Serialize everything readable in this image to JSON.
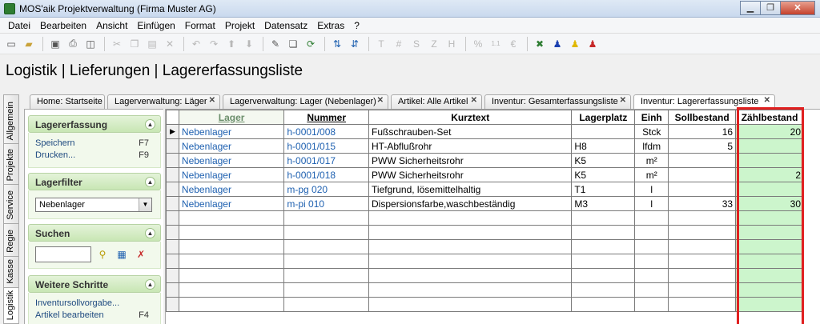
{
  "window": {
    "title": "MOS'aik Projektverwaltung (Firma Muster AG)",
    "minimize": "▁",
    "maximize": "❐",
    "close": "✕"
  },
  "menu": [
    "Datei",
    "Bearbeiten",
    "Ansicht",
    "Einfügen",
    "Format",
    "Projekt",
    "Datensatz",
    "Extras",
    "?"
  ],
  "breadcrumb": "Logistik | Lieferungen | Lagererfassungsliste",
  "tabs": [
    {
      "label": "Home: Startseite"
    },
    {
      "label": "Lagerverwaltung: Läger"
    },
    {
      "label": "Lagerverwaltung: Lager (Nebenlager)"
    },
    {
      "label": "Artikel: Alle Artikel"
    },
    {
      "label": "Inventur: Gesamterfassungsliste"
    },
    {
      "label": "Inventur: Lagererfassungsliste"
    }
  ],
  "tab_close": "✕",
  "side_tabs": [
    "Allgemein",
    "Projekte",
    "Service",
    "Regie",
    "Kasse",
    "Logistik"
  ],
  "panel": {
    "lagererfassung": {
      "title": "Lagererfassung",
      "items": [
        {
          "label": "Speichern",
          "shortcut": "F7"
        },
        {
          "label": "Drucken...",
          "shortcut": "F9"
        }
      ]
    },
    "lagerfilter": {
      "title": "Lagerfilter",
      "selected": "Nebenlager"
    },
    "suchen": {
      "title": "Suchen",
      "value": ""
    },
    "weitere": {
      "title": "Weitere Schritte",
      "items": [
        {
          "label": "Inventursollvorgabe...",
          "shortcut": ""
        },
        {
          "label": "Artikel bearbeiten",
          "shortcut": "F4"
        }
      ]
    },
    "collapse_glyph": "▲"
  },
  "table": {
    "columns": [
      "Lager",
      "Nummer",
      "Kurztext",
      "Lagerplatz",
      "Einh",
      "Sollbestand",
      "Zählbestand"
    ],
    "rows": [
      [
        "Nebenlager",
        "h-0001/008",
        "Fußschrauben-Set",
        "",
        "Stck",
        "16",
        "20"
      ],
      [
        "Nebenlager",
        "h-0001/015",
        "HT-Abflußrohr",
        "H8",
        "lfdm",
        "5",
        ""
      ],
      [
        "Nebenlager",
        "h-0001/017",
        "PWW Sicherheitsrohr",
        "K5",
        "m²",
        "",
        ""
      ],
      [
        "Nebenlager",
        "h-0001/018",
        "PWW Sicherheitsrohr",
        "K5",
        "m²",
        "",
        "2"
      ],
      [
        "Nebenlager",
        "m-pg 020",
        "Tiefgrund, lösemittelhaltig",
        "T1",
        "l",
        "",
        ""
      ],
      [
        "Nebenlager",
        "m-pi 010",
        "Dispersionsfarbe,waschbeständig",
        "M3",
        "l",
        "33",
        "30"
      ]
    ],
    "current_row_marker": "▶"
  }
}
